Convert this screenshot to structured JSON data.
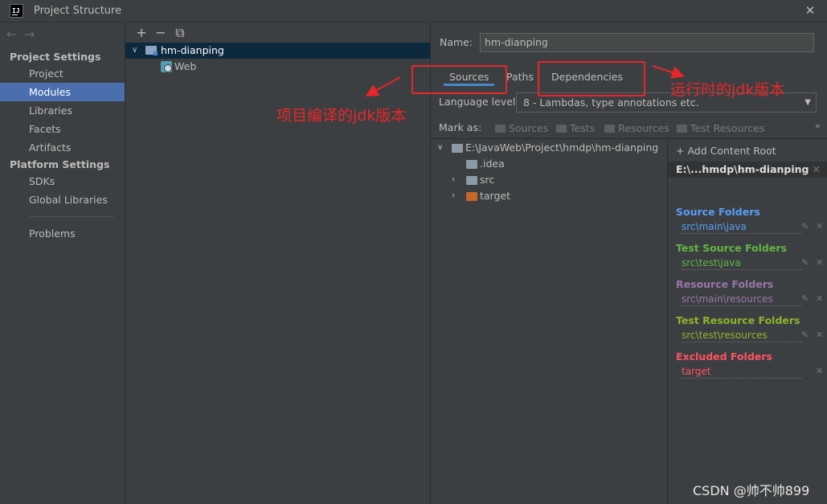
{
  "window": {
    "title": "Project Structure",
    "close_icon": "✕",
    "app_icon_text": "IJ"
  },
  "nav": {
    "back": "←",
    "forward": "→",
    "project_settings": "Project Settings",
    "project_items": [
      "Project",
      "Modules",
      "Libraries",
      "Facets",
      "Artifacts"
    ],
    "selected": "Modules",
    "platform_settings": "Platform Settings",
    "platform_items": [
      "SDKs",
      "Global Libraries"
    ],
    "problems": "Problems"
  },
  "module_tree": {
    "toolbar": {
      "add": "+",
      "remove": "−",
      "copy": "⧉"
    },
    "module_name": "hm-dianping",
    "facet": "Web"
  },
  "module": {
    "name_label": "Name:",
    "name_value": "hm-dianping",
    "tabs": [
      "Sources",
      "Paths",
      "Dependencies"
    ],
    "active_tab": "Sources",
    "language_level_label": "Language level:",
    "language_level_value": "8 - Lambdas, type annotations etc.",
    "mark_as_label": "Mark as:",
    "mark_as_buttons": [
      "Sources",
      "Tests",
      "Resources",
      "Test Resources"
    ],
    "expand_icon": "»"
  },
  "content_tree": {
    "root": "E:\\JavaWeb\\Project\\hmdp\\hm-dianping",
    "children": [
      ".idea",
      "src",
      "target"
    ]
  },
  "content_roots": {
    "add_label": "+ Add Content Root",
    "root_header": "E:\\...hmdp\\hm-dianping",
    "categories": [
      {
        "title": "Source Folders",
        "path": "src\\main\\java",
        "color": "#589df6"
      },
      {
        "title": "Test Source Folders",
        "path": "src\\test\\java",
        "color": "#62b543"
      },
      {
        "title": "Resource Folders",
        "path": "src\\main\\resources",
        "color": "#9876aa"
      },
      {
        "title": "Test Resource Folders",
        "path": "src\\test\\resources",
        "color": "#8db52c"
      },
      {
        "title": "Excluded Folders",
        "path": "target",
        "color": "#ff5261"
      }
    ]
  },
  "annotations": {
    "compile_jdk": "项目编译的jdk版本",
    "runtime_jdk": "运行时的jdk版本",
    "color": "#e8262a"
  },
  "watermark": "CSDN @帅不帅899"
}
